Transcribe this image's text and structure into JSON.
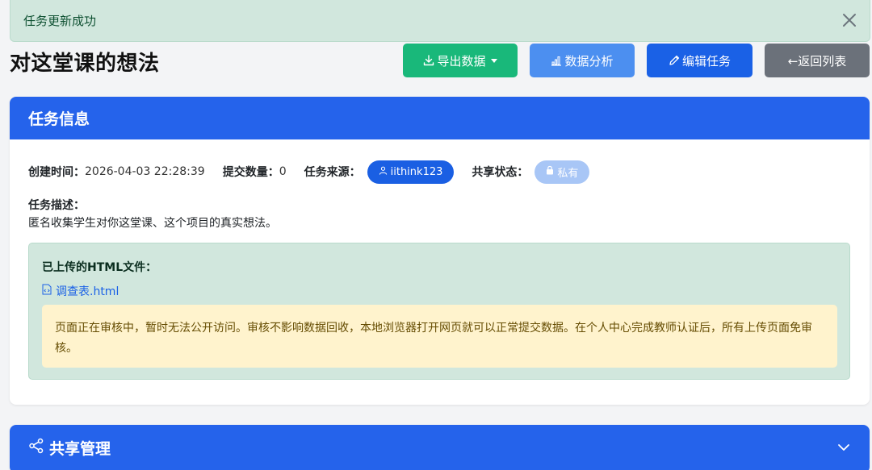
{
  "alert": {
    "message": "任务更新成功",
    "close_icon": "close-icon"
  },
  "page": {
    "title": "对这堂课的想法"
  },
  "toolbar": {
    "export_label": "导出数据",
    "analyze_label": "数据分析",
    "edit_label": "编辑任务",
    "back_label": "←返回列表"
  },
  "task_info": {
    "header": "任务信息",
    "created_label": "创建时间：",
    "created_value": "2026-04-03 22:28:39",
    "count_label": "提交数量：",
    "count_value": "0",
    "source_label": "任务来源：",
    "source_value": "iithink123",
    "share_label": "共享状态：",
    "share_value": "私有",
    "desc_label": "任务描述：",
    "desc_value": "匿名收集学生对你这堂课、这个项目的真实想法。",
    "files_title": "已上传的HTML文件：",
    "file_name": "调查表.html",
    "notice": "页面正在审核中，暂时无法公开访问。审核不影响数据回收，本地浏览器打开网页就可以正常提交数据。在个人中心完成教师认证后，所有上传页面免审核。"
  },
  "share_section": {
    "header": "共享管理"
  },
  "colors": {
    "primary": "#2563eb",
    "success": "#19b87a",
    "info": "#4c8ff0",
    "secondary": "#6b717a",
    "alert_bg": "#d1e7dd",
    "warning_bg": "#fff3cd"
  }
}
